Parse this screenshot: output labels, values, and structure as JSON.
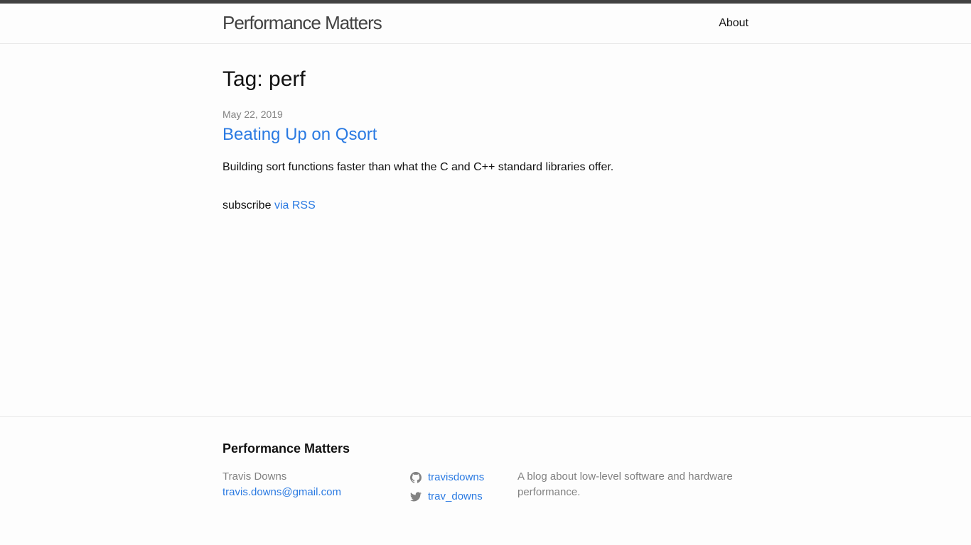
{
  "header": {
    "site_title": "Performance Matters",
    "nav": {
      "about_label": "About"
    }
  },
  "main": {
    "page_heading": "Tag: perf",
    "posts": [
      {
        "date": "May 22, 2019",
        "title": "Beating Up on Qsort",
        "excerpt": "Building sort functions faster than what the C and C++ standard libraries offer."
      }
    ],
    "subscribe_text": "subscribe",
    "rss_label": "via RSS"
  },
  "footer": {
    "heading": "Performance Matters",
    "author_name": "Travis Downs",
    "email": "travis.downs@gmail.com",
    "github": {
      "icon": "github-icon",
      "username": "travisdowns"
    },
    "twitter": {
      "icon": "twitter-icon",
      "username": "trav_downs"
    },
    "description": "A blog about low-level software and hardware performance."
  },
  "colors": {
    "link": "#2a7ae2",
    "text": "#111111",
    "muted": "#828282",
    "header_border": "#424242",
    "icon": "#828282"
  }
}
